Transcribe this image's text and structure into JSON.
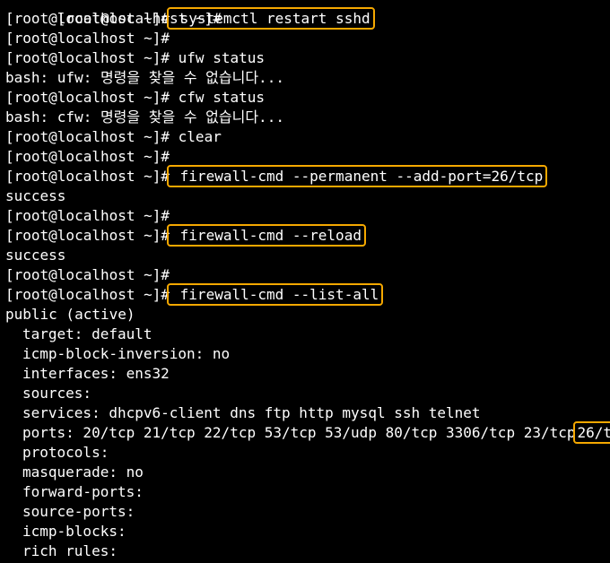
{
  "terminal": {
    "highlight_color": "#f5a800",
    "prompt": "[root@localhost ~]#",
    "lines": [
      {
        "prompt": "[root@localhost ~]#",
        "cmd": " systemctl restart sshd",
        "highlighted": true
      },
      {
        "prompt": "[root@localhost ~]#",
        "cmd": "",
        "highlighted": false
      },
      {
        "prompt": "[root@localhost ~]#",
        "cmd": " ufw status",
        "highlighted": false
      },
      {
        "text": "bash: ufw: 명령을 찾을 수 없습니다..."
      },
      {
        "prompt": "[root@localhost ~]#",
        "cmd": " cfw status",
        "highlighted": false
      },
      {
        "text": "bash: cfw: 명령을 찾을 수 없습니다..."
      },
      {
        "prompt": "[root@localhost ~]#",
        "cmd": " clear",
        "highlighted": false
      },
      {
        "prompt": "[root@localhost ~]#",
        "cmd": "",
        "highlighted": false
      },
      {
        "prompt": "[root@localhost ~]#",
        "cmd": " firewall-cmd --permanent --add-port=26/tcp",
        "highlighted": true
      },
      {
        "text": "success"
      },
      {
        "prompt": "[root@localhost ~]#",
        "cmd": "",
        "highlighted": false
      },
      {
        "prompt": "[root@localhost ~]#",
        "cmd": " firewall-cmd --reload",
        "highlighted": true
      },
      {
        "text": "success"
      },
      {
        "prompt": "[root@localhost ~]#",
        "cmd": "",
        "highlighted": false
      },
      {
        "prompt": "[root@localhost ~]#",
        "cmd": " firewall-cmd --list-all",
        "highlighted": true
      },
      {
        "text": "public (active)"
      }
    ],
    "zone": {
      "target": "target: default",
      "icmp_block_inversion": "icmp-block-inversion: no",
      "interfaces": "interfaces: ens32",
      "sources": "sources:",
      "services": "services: dhcpv6-client dns ftp http mysql ssh telnet",
      "ports_prefix": "ports: 20/tcp 21/tcp 22/tcp 53/tcp 53/udp 80/tcp 3306/tcp 23/tcp",
      "ports_highlight": "26/tcp",
      "protocols": "protocols:",
      "masquerade": "masquerade: no",
      "forward_ports": "forward-ports:",
      "source_ports": "source-ports:",
      "icmp_blocks": "icmp-blocks:",
      "rich_rules": "rich rules:"
    }
  }
}
